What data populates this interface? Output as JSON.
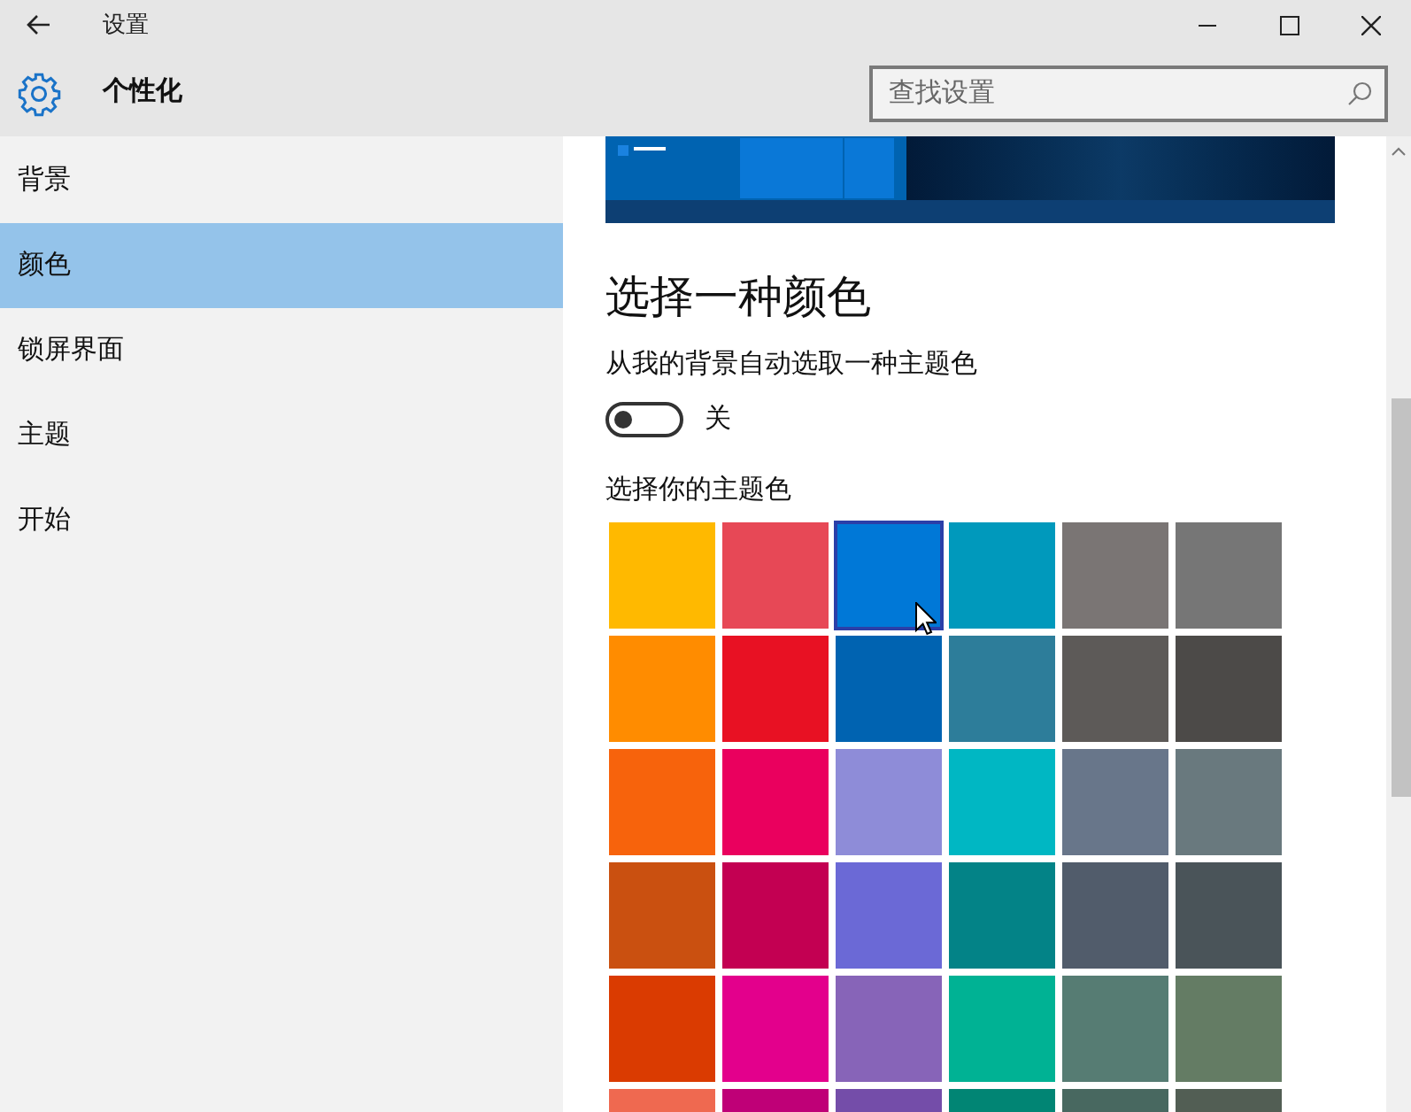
{
  "window": {
    "title": "设置"
  },
  "header": {
    "title": "个性化",
    "search": {
      "placeholder": "查找设置"
    }
  },
  "sidebar": {
    "items": [
      {
        "label": "背景",
        "selected": false
      },
      {
        "label": "颜色",
        "selected": true
      },
      {
        "label": "锁屏界面",
        "selected": false
      },
      {
        "label": "主题",
        "selected": false
      },
      {
        "label": "开始",
        "selected": false
      }
    ]
  },
  "content": {
    "heading": "选择一种颜色",
    "auto_color": {
      "label": "从我的背景自动选取一种主题色",
      "on": false,
      "state_text": "关"
    },
    "accent_label": "选择你的主题色",
    "swatches": [
      {
        "color": "#ffb900",
        "selected": false
      },
      {
        "color": "#e74856",
        "selected": false
      },
      {
        "color": "#0078d7",
        "selected": true
      },
      {
        "color": "#0099bc",
        "selected": false
      },
      {
        "color": "#7a7574",
        "selected": false
      },
      {
        "color": "#767676",
        "selected": false
      },
      {
        "color": "#ff8c00",
        "selected": false
      },
      {
        "color": "#e81123",
        "selected": false
      },
      {
        "color": "#0063b1",
        "selected": false
      },
      {
        "color": "#2d7d9a",
        "selected": false
      },
      {
        "color": "#5d5a58",
        "selected": false
      },
      {
        "color": "#4c4a48",
        "selected": false
      },
      {
        "color": "#f7630c",
        "selected": false
      },
      {
        "color": "#ea005e",
        "selected": false
      },
      {
        "color": "#8e8cd8",
        "selected": false
      },
      {
        "color": "#00b7c3",
        "selected": false
      },
      {
        "color": "#68768a",
        "selected": false
      },
      {
        "color": "#69797e",
        "selected": false
      },
      {
        "color": "#ca5010",
        "selected": false
      },
      {
        "color": "#c30052",
        "selected": false
      },
      {
        "color": "#6b69d6",
        "selected": false
      },
      {
        "color": "#038387",
        "selected": false
      },
      {
        "color": "#515c6b",
        "selected": false
      },
      {
        "color": "#4a5459",
        "selected": false
      },
      {
        "color": "#da3b01",
        "selected": false
      },
      {
        "color": "#e3008c",
        "selected": false
      },
      {
        "color": "#8764b8",
        "selected": false
      },
      {
        "color": "#00b294",
        "selected": false
      },
      {
        "color": "#567c73",
        "selected": false
      },
      {
        "color": "#647c64",
        "selected": false
      },
      {
        "color": "#ef6950",
        "selected": false
      },
      {
        "color": "#bf0077",
        "selected": false
      },
      {
        "color": "#744da9",
        "selected": false
      },
      {
        "color": "#018574",
        "selected": false
      },
      {
        "color": "#486860",
        "selected": false
      },
      {
        "color": "#525e54",
        "selected": false
      }
    ]
  }
}
